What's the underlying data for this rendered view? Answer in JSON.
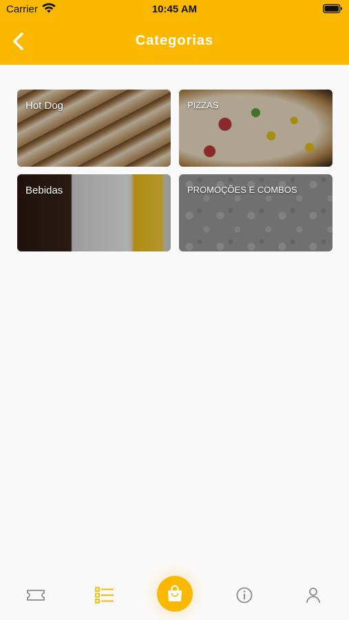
{
  "status_bar": {
    "carrier": "Carrier",
    "time": "10:45 AM"
  },
  "header": {
    "title": "Categorias",
    "back_icon": "chevron-left-icon"
  },
  "categories": [
    {
      "label": "Hot Dog"
    },
    {
      "label": "PIZZAS"
    },
    {
      "label": "Bebidas"
    },
    {
      "label": "PROMOÇÕES E COMBOS"
    }
  ],
  "tabbar": {
    "items": [
      {
        "icon": "ticket-icon",
        "active": false
      },
      {
        "icon": "list-icon",
        "active": true
      },
      {
        "icon": "shopping-bag-icon",
        "active": false
      },
      {
        "icon": "info-icon",
        "active": false
      },
      {
        "icon": "user-icon",
        "active": false
      }
    ]
  },
  "colors": {
    "accent": "#fbb801",
    "background": "#f9f9f9",
    "inactive_icon": "#8a8a8a"
  }
}
